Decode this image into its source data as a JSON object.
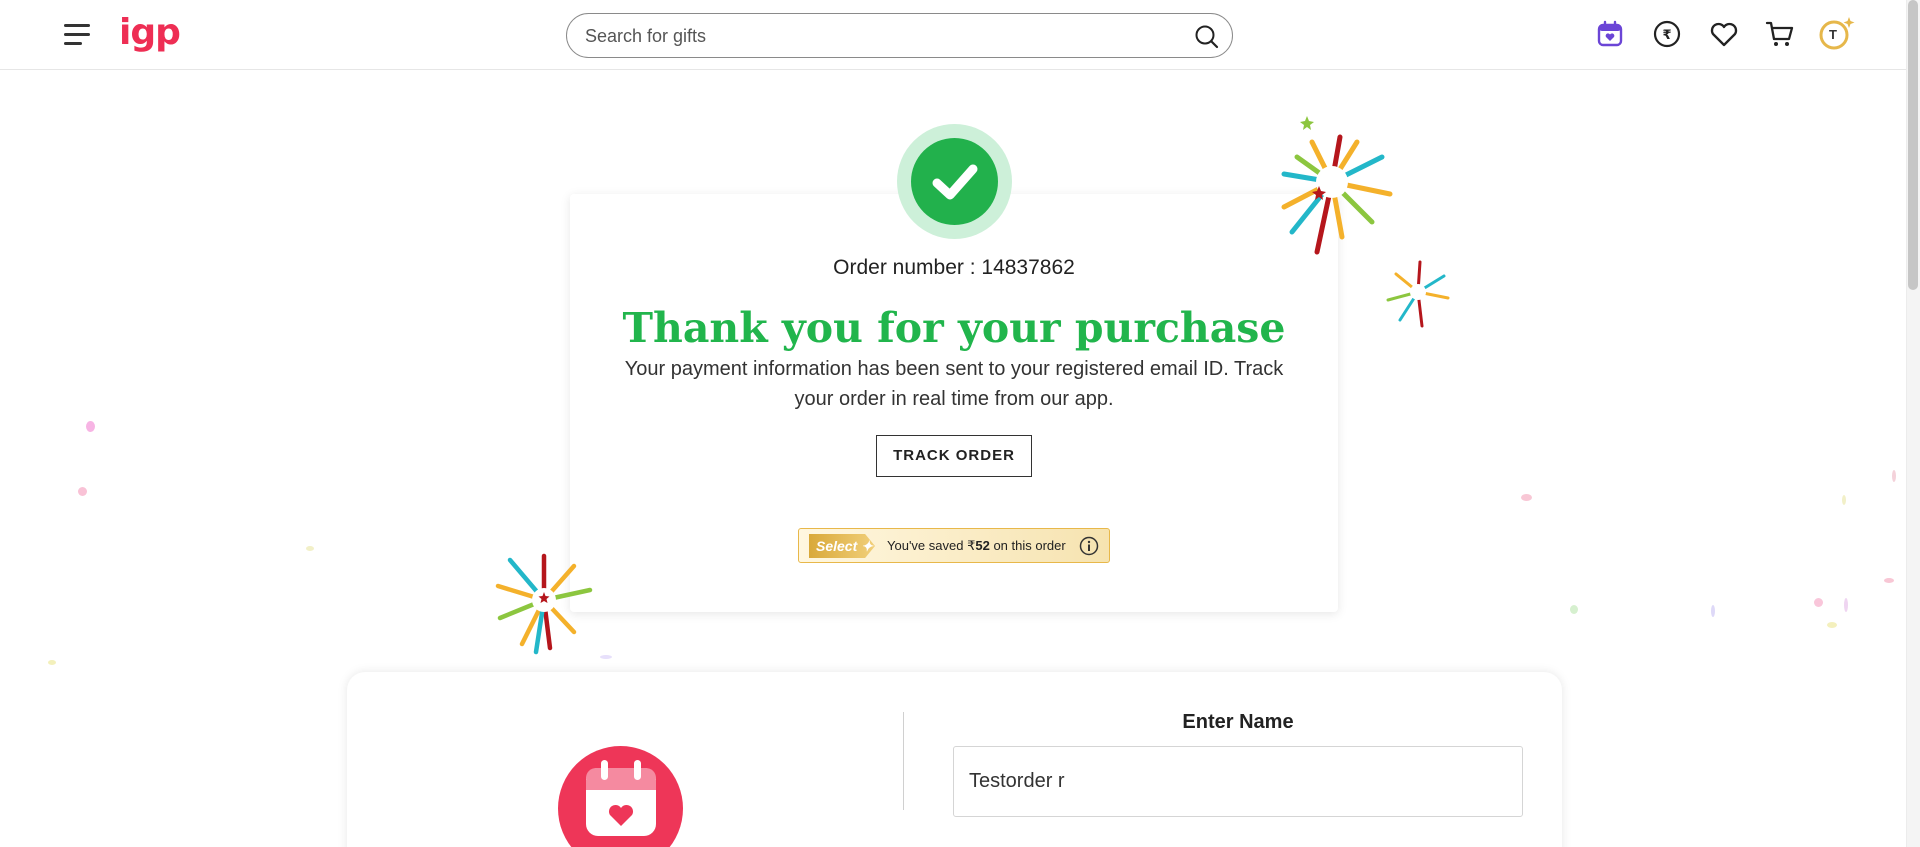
{
  "header": {
    "logo_text": "igp",
    "search_placeholder": "Search for gifts",
    "avatar_initial": "T",
    "brand_color": "#ee2e54",
    "icons": [
      "menu-icon",
      "search-icon",
      "calendar-heart-icon",
      "rupee-icon",
      "heart-icon",
      "cart-icon",
      "avatar-icon"
    ]
  },
  "order": {
    "order_number_text": "Order number : 14837862",
    "thank_you_title": "Thank you for your purchase",
    "description": "Your payment information has been sent to your registered email ID. Track your order in real time from our app.",
    "track_button": "TRACK ORDER",
    "success_color": "#22b14c"
  },
  "savings": {
    "badge_label": "Select",
    "prefix": "You've saved ₹",
    "amount": "52",
    "suffix": "on this order",
    "info_icon": "info-icon"
  },
  "reminder": {
    "name_label": "Enter Name",
    "name_value": "Testorder r",
    "icon": "calendar-heart-icon",
    "accent_color": "#ee3658"
  }
}
